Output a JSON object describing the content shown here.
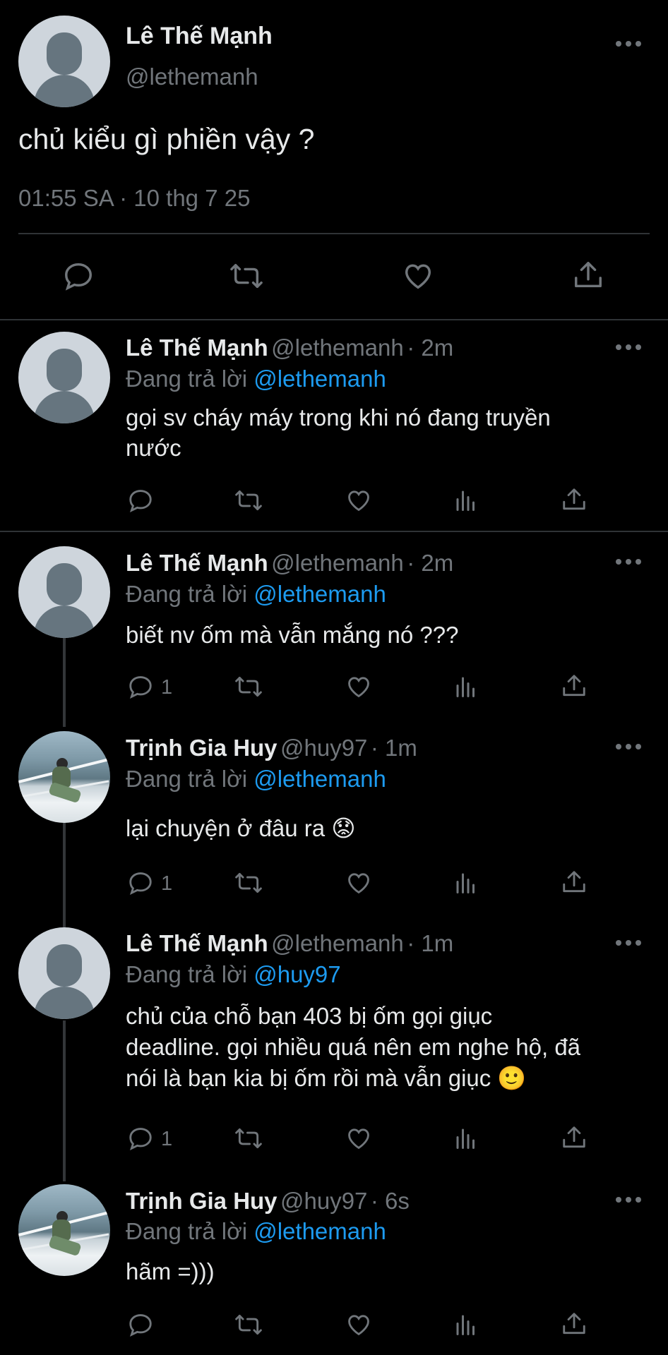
{
  "main_tweet": {
    "name": "Lê Thế Mạnh",
    "handle": "@lethemanh",
    "text": "chủ kiểu gì phiền vậy ?",
    "timestamp": "01:55 SA · 10 thg 7 25"
  },
  "replies": [
    {
      "name": "Lê Thế Mạnh",
      "handle": "@lethemanh",
      "time": "· 2m",
      "replying_label": "Đang trả lời",
      "replying_to": "@lethemanh",
      "text_lines": [
        "gọi sv cháy máy trong khi nó đang truyền",
        "nước"
      ],
      "reply_count": ""
    },
    {
      "name": "Lê Thế Mạnh",
      "handle": "@lethemanh",
      "time": "· 2m",
      "replying_label": "Đang trả lời",
      "replying_to": "@lethemanh",
      "text_lines": [
        "biết nv ốm mà vẫn mắng nó ???"
      ],
      "reply_count": "1"
    },
    {
      "name": "Trịnh Gia Huy",
      "handle": "@huy97",
      "time": "· 1m",
      "replying_label": "Đang trả lời",
      "replying_to": "@lethemanh",
      "text_lines": [
        "lại chuyện ở đâu ra 😟"
      ],
      "reply_count": "1"
    },
    {
      "name": "Lê Thế Mạnh",
      "handle": "@lethemanh",
      "time": "· 1m",
      "replying_label": "Đang trả lời",
      "replying_to": "@huy97",
      "text_lines": [
        "chủ của chỗ bạn 403 bị ốm gọi giục",
        "deadline. gọi nhiều quá nên em nghe hộ, đã",
        "nói là bạn kia bị ốm rồi mà vẫn giục 🙂"
      ],
      "reply_count": "1"
    },
    {
      "name": "Trịnh Gia Huy",
      "handle": "@huy97",
      "time": "· 6s",
      "replying_label": "Đang trả lời",
      "replying_to": "@lethemanh",
      "text_lines": [
        "hãm =)))"
      ],
      "reply_count": ""
    }
  ],
  "icons": {
    "reply": "reply-icon",
    "retweet": "retweet-icon",
    "like": "heart-icon",
    "views": "views-icon",
    "share": "share-icon",
    "more": "more-icon"
  },
  "colors": {
    "background": "#000000",
    "text": "#e7e9ea",
    "muted": "#71767b",
    "link": "#1d9bf0",
    "divider": "#2f3336"
  }
}
